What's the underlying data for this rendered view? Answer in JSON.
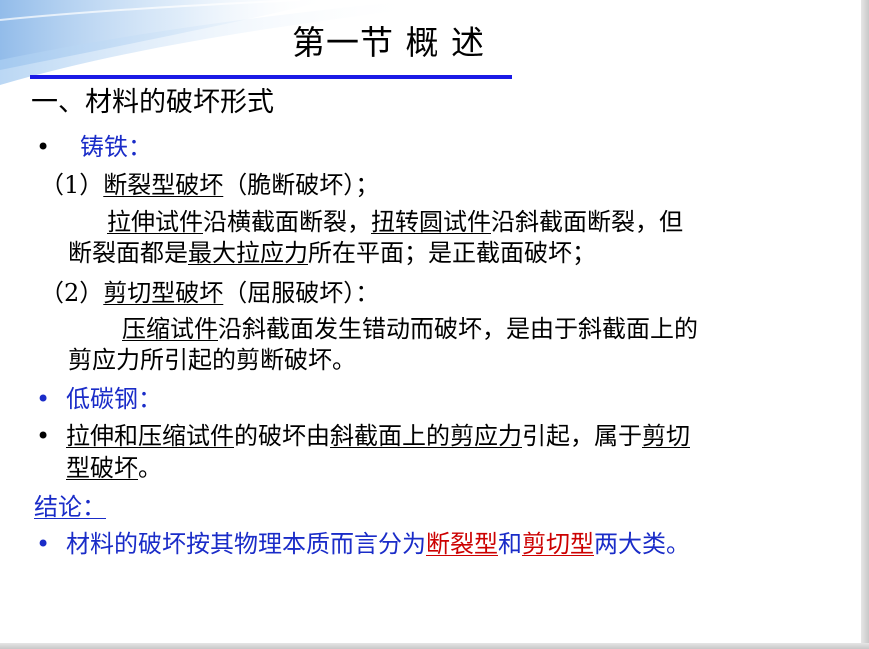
{
  "slide": {
    "title": "第一节  概    述",
    "heading": "一、材料的破坏形式",
    "bullet_symbol": "•",
    "cast_iron": "铸铁：",
    "brittle": {
      "num": "（1）",
      "type": "断裂型破坏",
      "desc": "（脆断破坏）；"
    },
    "brittle_text": {
      "p1": "拉伸试件",
      "p2": "沿横截面断裂，",
      "p3": "扭转圆试件",
      "p4": "沿斜截面断裂，但",
      "l2a": "断裂面都是",
      "l2b": "最大拉应力",
      "l2c": "所在平面；是正截面破坏；"
    },
    "shear": {
      "num": "（2）",
      "type": "剪切型破坏",
      "desc": "（屈服破坏）："
    },
    "shear_text": {
      "p1": "压缩试件",
      "p2": "沿斜截面发生错动而破坏，是由于斜截面上的",
      "l2": "剪应力所引起的剪断破坏。"
    },
    "low_carbon": "低碳钢：",
    "steel": {
      "p1": "拉伸和压缩试件",
      "p2": "的破坏由",
      "p3": "斜截面上的剪应力",
      "p4": "引起，属于",
      "p5": "剪切",
      "l2": "型破坏",
      "l2end": "。"
    },
    "conclusion_label": "结论：",
    "conclusion": {
      "p1": "材料的破坏按其物理本质而言分为",
      "p2": "断裂型",
      "p3": "和",
      "p4": "剪切型",
      "p5": "两大类。"
    }
  },
  "colors": {
    "accent_blue": "#1a2cc8",
    "rule_blue": "#1a1ae6",
    "highlight_red": "#cc0000",
    "text": "#000000"
  }
}
